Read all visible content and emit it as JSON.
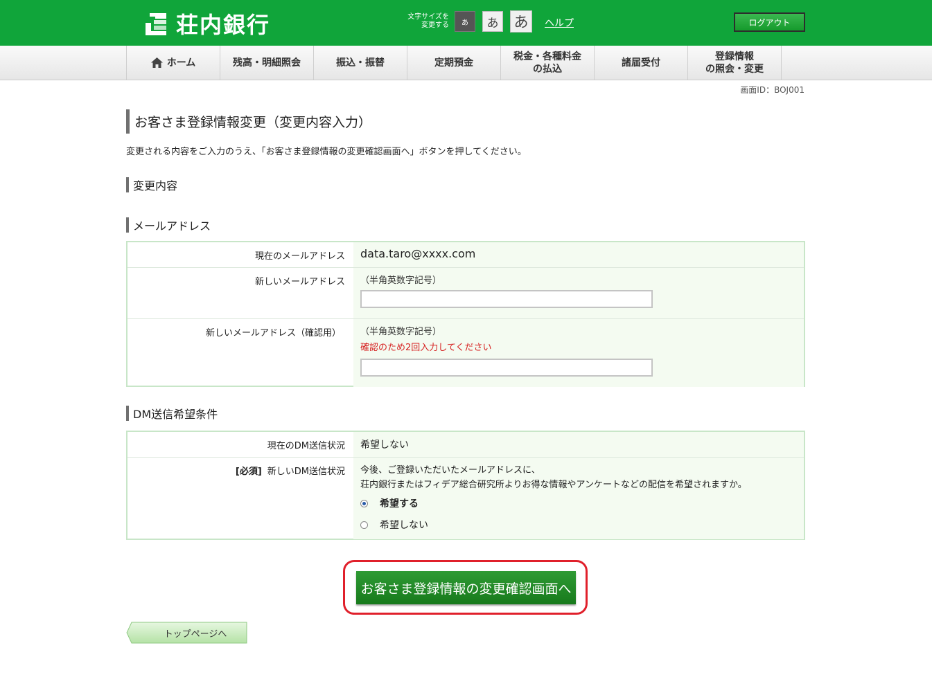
{
  "header": {
    "bank_name": "荘内銀行",
    "font_size_label_line1": "文字サイズを",
    "font_size_label_line2": "変更する",
    "font_size_small": "あ",
    "font_size_medium": "あ",
    "font_size_large": "あ",
    "help": "ヘルプ",
    "logout": "ログアウト",
    "brand_color": "#10a53a"
  },
  "nav": {
    "items": [
      {
        "label": "ホーム",
        "icon": "home-icon"
      },
      {
        "label": "残高・明細照会"
      },
      {
        "label": "振込・振替"
      },
      {
        "label": "定期預金"
      },
      {
        "label_line1": "税金・各種料金",
        "label_line2": "の払込"
      },
      {
        "label": "諸届受付"
      },
      {
        "label_line1": "登録情報",
        "label_line2": "の照会・変更"
      }
    ]
  },
  "screen_id": "画面ID：BOJ001",
  "page": {
    "title": "お客さま登録情報変更（変更内容入力）",
    "lead": "変更される内容をご入力のうえ、「お客さま登録情報の変更確認画面へ」ボタンを押してください。",
    "section_change": "変更内容"
  },
  "email": {
    "section": "メールアドレス",
    "current_label": "現在のメールアドレス",
    "current_value": "data.taro@xxxx.com",
    "new_label": "新しいメールアドレス",
    "new_note": "（半角英数字記号）",
    "new_value": "",
    "confirm_label": "新しいメールアドレス（確認用）",
    "confirm_note": "（半角英数字記号）",
    "confirm_warning": "確認のため2回入力してください",
    "confirm_value": ""
  },
  "dm": {
    "section": "DM送信希望条件",
    "current_label": "現在のDM送信状況",
    "current_value": "希望しない",
    "required_tag": "[必須]",
    "new_label": "新しいDM送信状況",
    "desc_line1": "今後、ご登録いただいたメールアドレスに、",
    "desc_line2": "荘内銀行またはフィデア総合研究所よりお得な情報やアンケートなどの配信を希望されますか。",
    "options": [
      {
        "label": "希望する",
        "selected": true
      },
      {
        "label": "希望しない",
        "selected": false
      }
    ]
  },
  "actions": {
    "confirm": "お客さま登録情報の変更確認画面へ",
    "top_page": "トップページへ"
  }
}
